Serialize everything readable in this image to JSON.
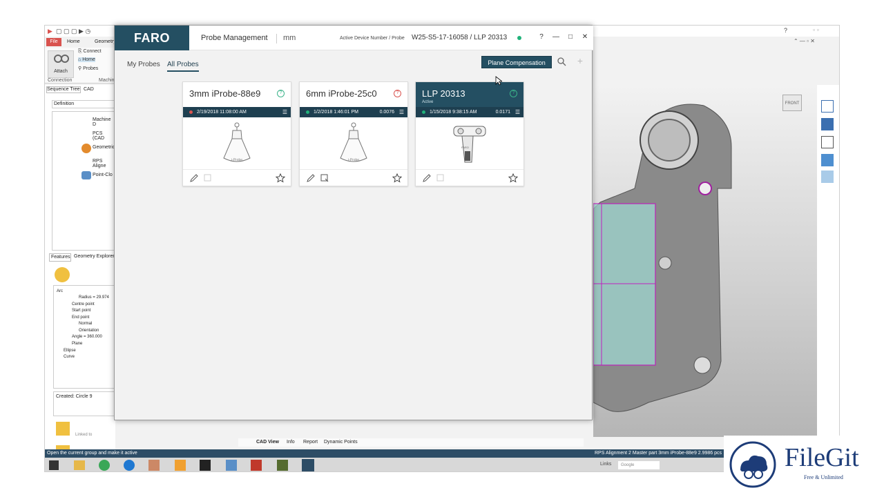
{
  "app": {
    "ribbon_tabs": [
      "File",
      "Home",
      "Geometry"
    ],
    "ribbon_items": [
      "Connect",
      "Home",
      "Probes",
      "Attach"
    ],
    "ribbon_groups": [
      "Connection",
      "Machine"
    ],
    "panel_tabs": [
      "Sequence Tree",
      "CAD"
    ],
    "definition_label": "Definition",
    "sequence_items": [
      "Machine D",
      "PCS (CAD",
      "Geometric",
      "RPS Aligne",
      "Point-Clo"
    ],
    "features_tabs": [
      "Features",
      "Geometry Explorer"
    ],
    "geo_tree": [
      "Arc",
      "Radius = 29.974",
      "Centre point",
      "Start point",
      "End point",
      "Normal",
      "Orientation",
      "Angle = 360.000",
      "Plane",
      "Ellipse",
      "Curve"
    ],
    "created_label": "Created: Circle 9",
    "linked_to": "Linked to",
    "status_left": "Open the current group and make it active",
    "status_right": "RPS Alignment 2  Master part  3mm iProbe-88e9 2.9986  pcs",
    "bottom_tabs": [
      "CAD View",
      "Info",
      "Report",
      "Dynamic Points"
    ],
    "front_label": "FRONT",
    "links_label": "Links",
    "google_label": "Google"
  },
  "dialog": {
    "logo": "FARO",
    "title": "Probe Management",
    "units": "mm",
    "device_label": "Active Device Number / Probe",
    "device_value": "W25-S5-17-16058 / LLP 20313",
    "win_buttons": [
      "?",
      "—",
      "□",
      "✕"
    ],
    "tabs": [
      "My Probes",
      "All Probes"
    ],
    "plane_button": "Plane Compensation",
    "cards": [
      {
        "name": "3mm iProbe-88e9",
        "date": "2/19/2018 11:08:00 AM",
        "value": "",
        "sub": "",
        "status_color": "#3bb38a",
        "dot_color": "#d9534f",
        "image": "iProbe"
      },
      {
        "name": "6mm iProbe-25c0",
        "date": "1/2/2018 1:46:01 PM",
        "value": "0.0076",
        "sub": "",
        "status_color": "#d9534f",
        "dot_color": "#20b27a",
        "image": "iProbe"
      },
      {
        "name": "LLP 20313",
        "date": "1/15/2018 9:38:15 AM",
        "value": "0.0171",
        "sub": "Active",
        "status_color": "#3bb38a",
        "dot_color": "#20b27a",
        "image": "LLP"
      }
    ]
  },
  "watermark": {
    "brand": "FileGit",
    "tagline": "Free & Unlimited"
  }
}
